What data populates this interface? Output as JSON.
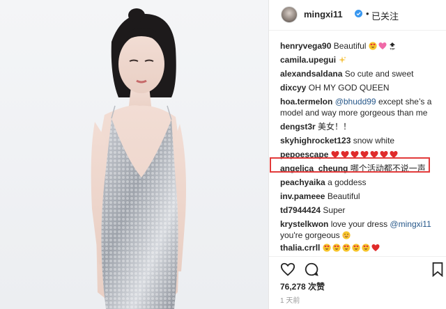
{
  "post": {
    "username": "mingxi11",
    "follow_status": "已关注",
    "dot": "•",
    "likes": "76,278 次赞",
    "time": "1 天前"
  },
  "comments": [
    {
      "user": "henryvega90",
      "text": "Beautiful",
      "emoji": [
        "heart-eyes-icon",
        "pink-heart-icon",
        "top-icon"
      ]
    },
    {
      "user": "camila.upegui",
      "text": "",
      "emoji": [
        "sparkles-icon"
      ]
    },
    {
      "user": "alexandsaldana",
      "text": "So cute and sweet",
      "emoji": []
    },
    {
      "user": "dixcyy",
      "text": "OH MY GOD QUEEN",
      "emoji": []
    },
    {
      "user": "hoa.termelon",
      "mention": "@bhudd99",
      "text": " except she’s a",
      "text2": "model and way more gorgeous than me",
      "emoji": []
    },
    {
      "user": "dengst3r",
      "text": "美女！！",
      "emoji": []
    },
    {
      "user": "skyhighrocket123",
      "text": "snow white",
      "emoji": []
    },
    {
      "user": "pepoescape",
      "text": "",
      "emoji": [
        "red-heart-icon",
        "red-heart-icon",
        "red-heart-icon",
        "red-heart-icon",
        "red-heart-icon",
        "red-heart-icon",
        "red-heart-icon"
      ]
    },
    {
      "user": "angelica_cheung",
      "text": "哪个活动都不说一声",
      "emoji": []
    },
    {
      "user": "peachyaika",
      "text": "a goddess",
      "emoji": []
    },
    {
      "user": "inv.pameee",
      "text": "Beautiful",
      "emoji": []
    },
    {
      "user": "td7944424",
      "text": "Super",
      "emoji": []
    },
    {
      "user": "krystelkwon",
      "text": "love your dress ",
      "mention": "@mingxi11",
      "text2": "you're gorgeous",
      "emoji": [
        "smiling-blush-icon"
      ]
    },
    {
      "user": "thalia.crrll",
      "text": "",
      "emoji": [
        "heart-eyes-icon",
        "heart-eyes-icon",
        "heart-eyes-icon",
        "heart-eyes-icon",
        "heart-eyes-icon",
        "red-heart-icon"
      ]
    }
  ],
  "colors": {
    "highlight": "#e23a3a",
    "mention": "#27588a",
    "verified": "#3897f0"
  }
}
